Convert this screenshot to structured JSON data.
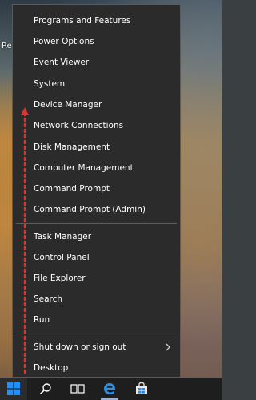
{
  "desktop": {
    "peek_text": "Re"
  },
  "menu": {
    "items_group1": [
      {
        "label": "Programs and Features"
      },
      {
        "label": "Power Options"
      },
      {
        "label": "Event Viewer"
      },
      {
        "label": "System"
      },
      {
        "label": "Device Manager"
      },
      {
        "label": "Network Connections"
      },
      {
        "label": "Disk Management"
      },
      {
        "label": "Computer Management"
      },
      {
        "label": "Command Prompt"
      },
      {
        "label": "Command Prompt (Admin)"
      }
    ],
    "items_group2": [
      {
        "label": "Task Manager"
      },
      {
        "label": "Control Panel"
      },
      {
        "label": "File Explorer"
      },
      {
        "label": "Search"
      },
      {
        "label": "Run"
      }
    ],
    "items_group3": [
      {
        "label": "Shut down or sign out",
        "has_submenu": true
      },
      {
        "label": "Desktop"
      }
    ]
  },
  "annotation": {
    "color": "#e0322f",
    "style": "dotted-arrow-up"
  },
  "taskbar": {
    "icons": [
      "windows-start-icon",
      "search-icon",
      "task-view-icon",
      "edge-icon",
      "store-icon"
    ],
    "accent": "#1e90ff"
  }
}
